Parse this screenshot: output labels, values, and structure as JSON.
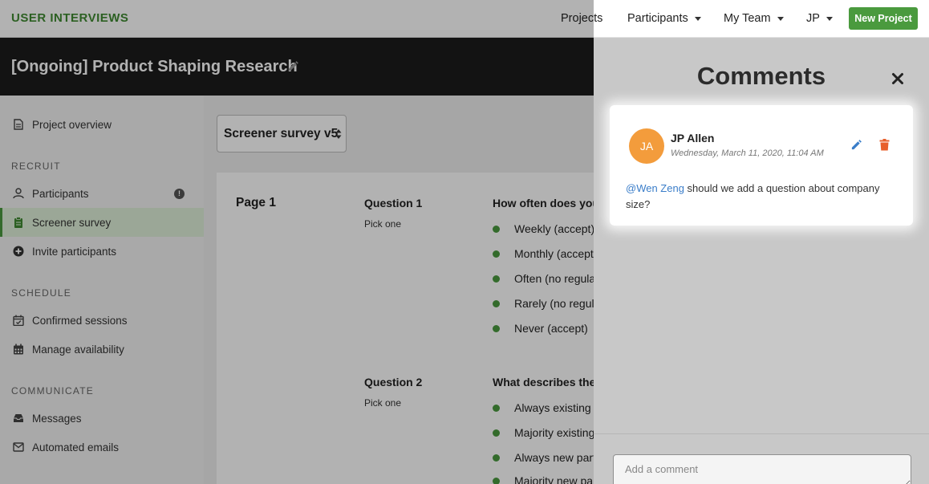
{
  "nav": {
    "brand": "USER INTERVIEWS",
    "projects": "Projects",
    "participants": "Participants",
    "my_team": "My Team",
    "user": "JP",
    "new_project": "New Project"
  },
  "project": {
    "title": "[Ongoing] Product Shaping Research"
  },
  "sidebar": {
    "overview": "Project overview",
    "recruit_section": "RECRUIT",
    "participants": "Participants",
    "screener_survey": "Screener survey",
    "invite_participants": "Invite participants",
    "schedule_section": "SCHEDULE",
    "confirmed_sessions": "Confirmed sessions",
    "manage_availability": "Manage availability",
    "communicate_section": "COMMUNICATE",
    "messages": "Messages",
    "automated_emails": "Automated emails",
    "alert_glyph": "!"
  },
  "main": {
    "survey_select": "Screener survey v5",
    "page_label": "Page 1",
    "q1": {
      "title": "Question 1",
      "type": "Pick one",
      "text": "How often does your",
      "options": [
        "Weekly (accept)",
        "Monthly (accept",
        "Often (no regula",
        "Rarely (no regul",
        "Never (accept)"
      ]
    },
    "q2": {
      "title": "Question 2",
      "type": "Pick one",
      "text": "What describes the t",
      "options": [
        "Always existing (",
        "Majority existing",
        "Always new part",
        "Majority new pa"
      ]
    }
  },
  "comments": {
    "title": "Comments",
    "comment": {
      "initials": "JA",
      "author": "JP Allen",
      "date": "Wednesday, March 11, 2020, 11:04 AM",
      "mention": "@Wen Zeng",
      "body": " should we add a question about company size?"
    },
    "input_placeholder": "Add a comment"
  },
  "colors": {
    "brand_green": "#3f8a32",
    "button_green": "#4a9a3e",
    "avatar_orange": "#f39c3c",
    "edit_blue": "#3a7dc9",
    "delete_orange": "#e8602c"
  }
}
